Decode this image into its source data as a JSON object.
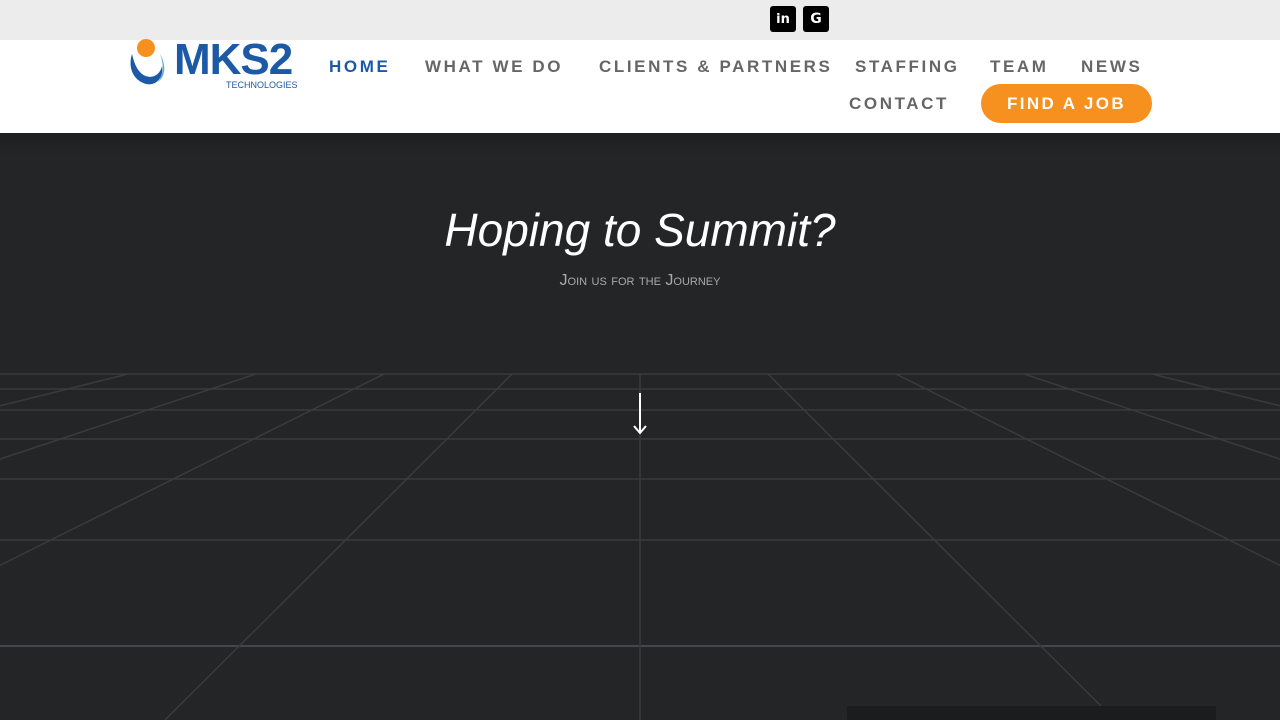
{
  "social": {
    "linkedin": "in",
    "google": "G"
  },
  "logo": {
    "name": "MKS2",
    "sub": "TECHNOLOGIES"
  },
  "nav": {
    "home": "HOME",
    "what_we_do": "WHAT WE DO",
    "clients": "CLIENTS & PARTNERS",
    "staffing": "STAFFING",
    "team": "TEAM",
    "news": "NEWS",
    "contact": "CONTACT",
    "find_job": "FIND A JOB"
  },
  "hero": {
    "title": "Hoping to Summit?",
    "subtitle": "Join us for the Journey"
  },
  "colors": {
    "brand_blue": "#1d5aa6",
    "accent_orange": "#f6901e",
    "hero_bg": "#242527"
  }
}
